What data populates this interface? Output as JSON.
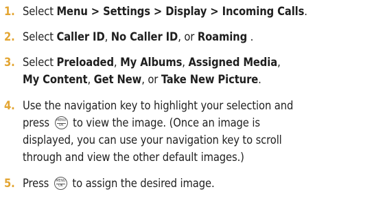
{
  "steps": [
    {
      "number": "1.",
      "lines": [
        [
          {
            "t": "Select ",
            "b": false
          },
          {
            "t": "Menu > Settings > Display > Incoming Calls",
            "b": true
          },
          {
            "t": ".",
            "b": false
          }
        ]
      ]
    },
    {
      "number": "2.",
      "lines": [
        [
          {
            "t": "Select ",
            "b": false
          },
          {
            "t": "Caller ID",
            "b": true
          },
          {
            "t": ", ",
            "b": false
          },
          {
            "t": "No Caller ID",
            "b": true
          },
          {
            "t": ", or ",
            "b": false
          },
          {
            "t": "Roaming",
            "b": true
          },
          {
            "t": " .",
            "b": false
          }
        ]
      ]
    },
    {
      "number": "3.",
      "lines": [
        [
          {
            "t": "Select ",
            "b": false
          },
          {
            "t": "Preloaded",
            "b": true
          },
          {
            "t": ", ",
            "b": false
          },
          {
            "t": "My Albums",
            "b": true
          },
          {
            "t": ", ",
            "b": false
          },
          {
            "t": "Assigned Media",
            "b": true
          },
          {
            "t": ",",
            "b": false
          }
        ],
        [
          {
            "t": "My Content",
            "b": true
          },
          {
            "t": ", ",
            "b": false
          },
          {
            "t": "Get New",
            "b": true
          },
          {
            "t": ", or ",
            "b": false
          },
          {
            "t": "Take New Picture",
            "b": true
          },
          {
            "t": ".",
            "b": false
          }
        ]
      ]
    },
    {
      "number": "4.",
      "lines": [
        [
          {
            "t": "Use the navigation key to highlight your selection and",
            "b": false
          }
        ],
        [
          {
            "t": "press ",
            "b": false
          },
          {
            "key": "menu-ok-key"
          },
          {
            "t": " to view the image. (Once an image is",
            "b": false
          }
        ],
        [
          {
            "t": "displayed, you can use your navigation key to scroll",
            "b": false
          }
        ],
        [
          {
            "t": "through and view the other default images.)",
            "b": false
          }
        ]
      ]
    },
    {
      "number": "5.",
      "lines": [
        [
          {
            "t": "Press ",
            "b": false
          },
          {
            "key": "menu-ok-key"
          },
          {
            "t": " to assign the desired image.",
            "b": false
          }
        ]
      ]
    }
  ],
  "key_glyph": {
    "top": "MENU",
    "bottom": "OK"
  },
  "colors": {
    "number": "#e3a532",
    "text": "#1f1f1f"
  }
}
